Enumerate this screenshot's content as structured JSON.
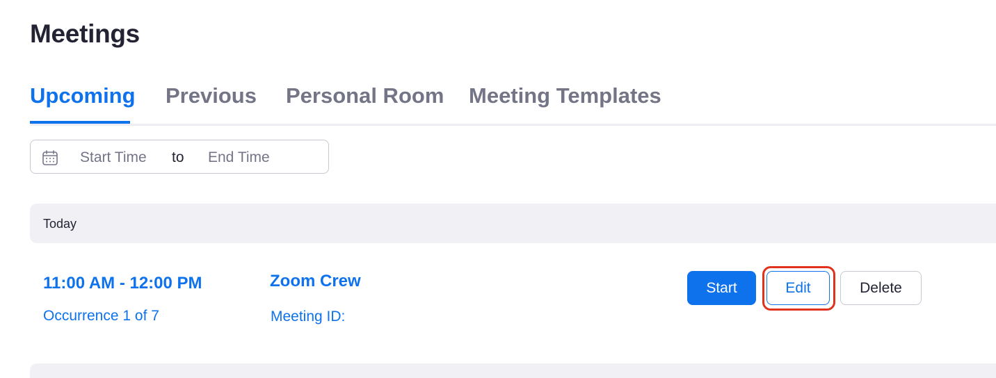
{
  "page": {
    "title": "Meetings"
  },
  "tabs": [
    {
      "label": "Upcoming",
      "active": true
    },
    {
      "label": "Previous",
      "active": false
    },
    {
      "label": "Personal Room",
      "active": false
    },
    {
      "label": "Meeting Templates",
      "active": false
    }
  ],
  "date_filter": {
    "icon": "calendar-icon",
    "start_placeholder": "Start Time",
    "separator": "to",
    "end_placeholder": "End Time"
  },
  "schedule": {
    "day_label": "Today",
    "meeting": {
      "time": "11:00 AM - 12:00 PM",
      "occurrence": "Occurrence 1 of 7",
      "topic": "Zoom Crew",
      "meeting_id_label": "Meeting ID:"
    }
  },
  "actions": {
    "start_label": "Start",
    "edit_label": "Edit",
    "delete_label": "Delete"
  },
  "colors": {
    "accent": "#0e72ed",
    "text": "#232333",
    "muted": "#747487",
    "highlight": "#e0321c",
    "section_bg": "#f1f1f5"
  }
}
